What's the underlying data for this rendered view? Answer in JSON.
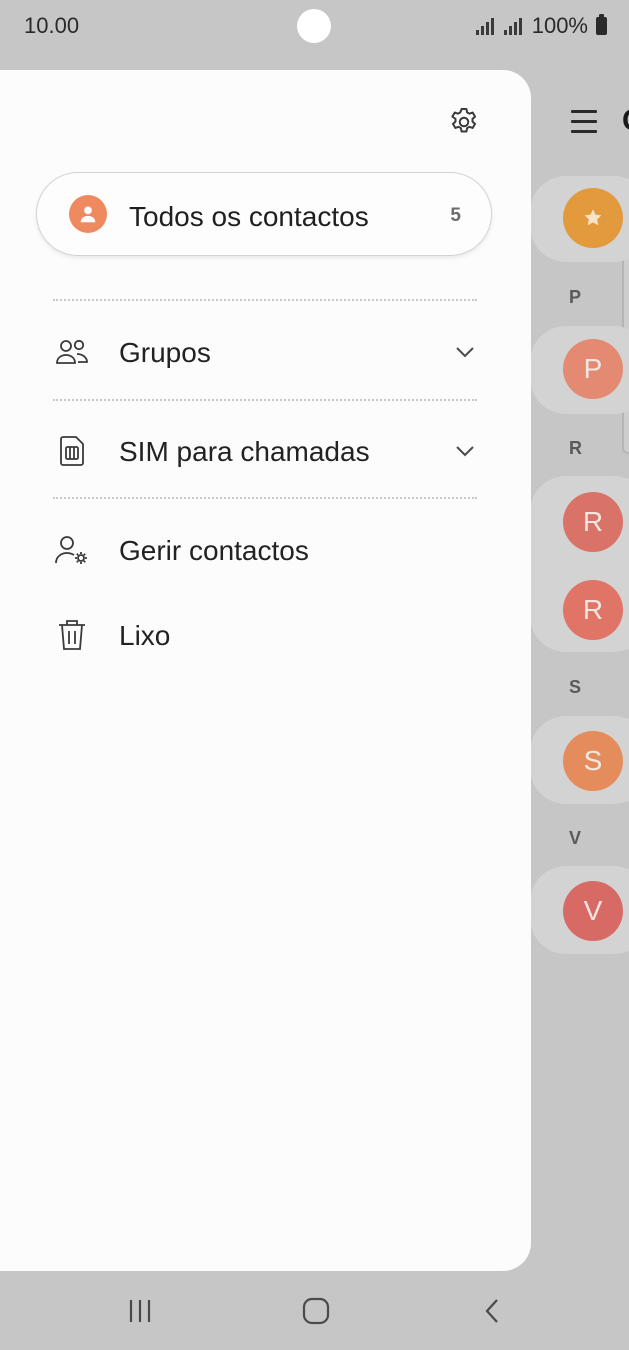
{
  "status": {
    "time": "10.00",
    "battery": "100%"
  },
  "drawer": {
    "all_contacts": {
      "label": "Todos os contactos",
      "count": "5"
    },
    "menu": [
      {
        "label": "Grupos",
        "icon": "group-icon",
        "expandable": true
      },
      {
        "label": "SIM para chamadas",
        "icon": "sim-card-icon",
        "expandable": true
      },
      {
        "label": "Gerir contactos",
        "icon": "manage-contacts-icon",
        "expandable": false
      },
      {
        "label": "Lixo",
        "icon": "trash-icon",
        "expandable": false
      }
    ]
  },
  "background": {
    "title_fragment": "C",
    "sections": [
      {
        "letter": "P",
        "avatars": [
          "P"
        ]
      },
      {
        "letter": "R",
        "avatars": [
          "R",
          "R"
        ]
      },
      {
        "letter": "S",
        "avatars": [
          "S"
        ]
      },
      {
        "letter": "V",
        "avatars": [
          "V"
        ]
      }
    ]
  },
  "colors": {
    "accent": "#ef8a60",
    "favorites": "#e39a3c",
    "avatar_p": "#e48a72",
    "avatar_r": "#d97368",
    "avatar_s": "#e58c5c",
    "avatar_v": "#d86a66"
  }
}
